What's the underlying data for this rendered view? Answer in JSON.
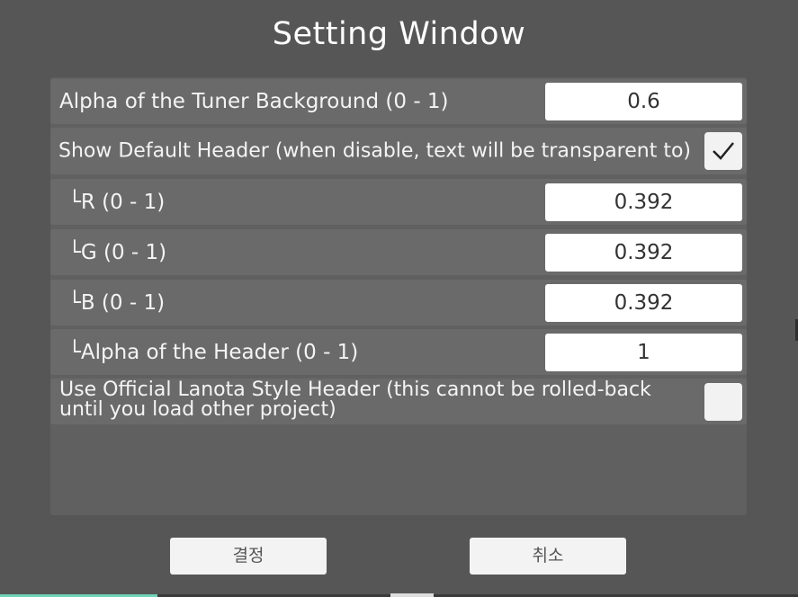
{
  "window": {
    "title": "Setting Window"
  },
  "settings": {
    "tuner_alpha": {
      "label": "Alpha of the Tuner Background (0 - 1)",
      "value": "0.6"
    },
    "show_default_header": {
      "label": "Show Default Header (when disable, text will be transparent to)",
      "checked": true
    },
    "header_r": {
      "label": "└R (0 - 1)",
      "value": "0.392"
    },
    "header_g": {
      "label": "└G (0 - 1)",
      "value": "0.392"
    },
    "header_b": {
      "label": "└B (0 - 1)",
      "value": "0.392"
    },
    "header_alpha": {
      "label": "└Alpha of the Header (0 - 1)",
      "value": "1"
    },
    "official_lanota": {
      "label_line1": "Use Official Lanota Style Header (this cannot be rolled-back",
      "label_line2": "until you load other project)",
      "checked": false
    }
  },
  "buttons": {
    "confirm": "결정",
    "cancel": "취소"
  },
  "colors": {
    "background": "#565656",
    "row": "#6a6a6a",
    "field": "#ffffff",
    "accent_strip": "#6fd3b8"
  },
  "icons": {
    "checkmark": "check-icon"
  }
}
